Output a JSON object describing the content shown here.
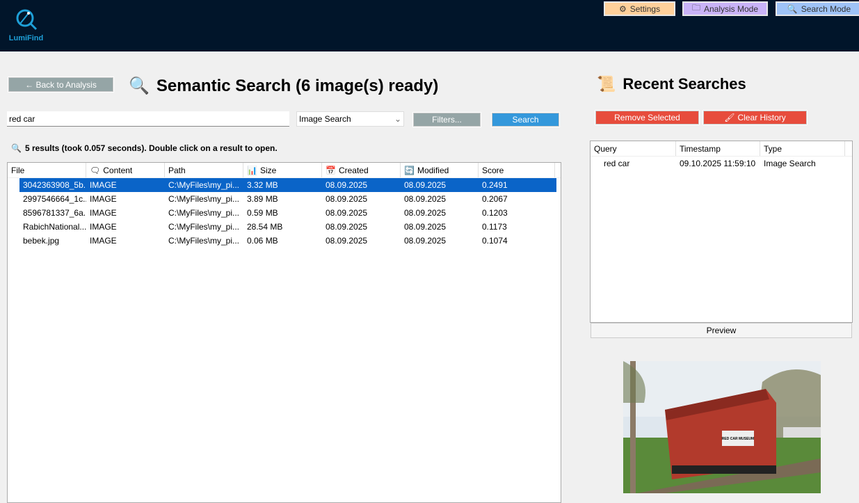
{
  "app": {
    "logo_text": "LumiFind"
  },
  "topbar": {
    "settings": "Settings",
    "analysis": "Analysis Mode",
    "search": "Search Mode",
    "colors": {
      "settings": "#ffd09b",
      "analysis": "#c9b3f7",
      "search": "#9fc3f7"
    }
  },
  "main": {
    "back_label": "← Back to Analysis",
    "title": "Semantic Search (6 image(s) ready)",
    "query": "red car",
    "search_type": "Image Search",
    "filters_label": "Filters...",
    "search_label": "Search",
    "status": "5 results (took 0.057 seconds). Double click on a result to open.",
    "columns": [
      "File",
      "Content",
      "Path",
      "Size",
      "Created",
      "Modified",
      "Score"
    ],
    "rows": [
      [
        "3042363908_5b...",
        "IMAGE",
        "C:\\MyFiles\\my_pi...",
        "3.32 MB",
        "08.09.2025",
        "08.09.2025",
        "0.2491"
      ],
      [
        "2997546664_1c...",
        "IMAGE",
        "C:\\MyFiles\\my_pi...",
        "3.89 MB",
        "08.09.2025",
        "08.09.2025",
        "0.2067"
      ],
      [
        "8596781337_6a...",
        "IMAGE",
        "C:\\MyFiles\\my_pi...",
        "0.59 MB",
        "08.09.2025",
        "08.09.2025",
        "0.1203"
      ],
      [
        "RabichNational...",
        "IMAGE",
        "C:\\MyFiles\\my_pi...",
        "28.54 MB",
        "08.09.2025",
        "08.09.2025",
        "0.1173"
      ],
      [
        "bebek.jpg",
        "IMAGE",
        "C:\\MyFiles\\my_pi...",
        "0.06 MB",
        "08.09.2025",
        "08.09.2025",
        "0.1074"
      ]
    ]
  },
  "recent": {
    "title": "Recent Searches",
    "remove_label": "Remove Selected",
    "clear_label": "Clear History",
    "columns": [
      "Query",
      "Timestamp",
      "Type"
    ],
    "rows": [
      [
        "red car",
        "09.10.2025 11:59:10",
        "Image Search"
      ]
    ],
    "preview_label": "Preview",
    "preview_sign": "RED CAR MUSEUM"
  }
}
